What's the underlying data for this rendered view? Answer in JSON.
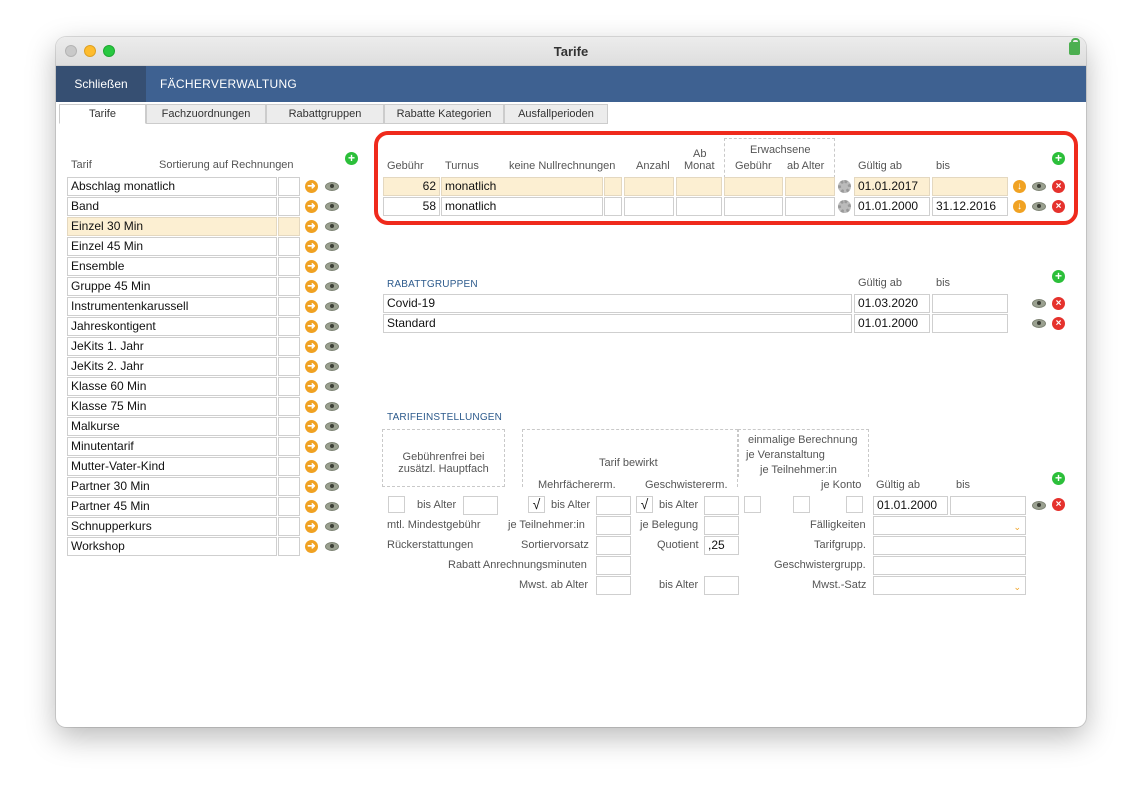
{
  "window": {
    "title": "Tarife"
  },
  "nav": {
    "close": "Schließen",
    "title": "FÄCHERVERWALTUNG"
  },
  "tabs": [
    "Tarife",
    "Fachzuordnungen",
    "Rabattgruppen",
    "Rabatte Kategorien",
    "Ausfallperioden"
  ],
  "left": {
    "header_tarif": "Tarif",
    "header_sort": "Sortierung auf Rechnungen",
    "items": [
      "Abschlag monatlich",
      "Band",
      "Einzel 30 Min",
      "Einzel 45 Min",
      "Ensemble",
      "Gruppe 45 Min",
      "Instrumentenkarussell",
      "Jahreskontigent",
      "JeKits 1. Jahr",
      "JeKits 2. Jahr",
      "Klasse 60 Min",
      "Klasse 75 Min",
      "Malkurse",
      "Minutentarif",
      "Mutter-Vater-Kind",
      "Partner 30 Min",
      "Partner 45 Min",
      "Schnupperkurs",
      "Workshop"
    ],
    "selected": "Einzel 30 Min"
  },
  "fees": {
    "headers": {
      "gebuehr": "Gebühr",
      "turnus": "Turnus",
      "keine": "keine Nullrechnungen",
      "anzahl": "Anzahl",
      "ab": "Ab",
      "monat": "Monat",
      "erwachsene": "Erwachsene",
      "erw_gebuehr": "Gebühr",
      "ab_alter": "ab Alter",
      "gueltig": "Gültig ab",
      "bis": "bis"
    },
    "rows": [
      {
        "gebuehr": "62",
        "turnus": "monatlich",
        "gueltig": "01.01.2017",
        "bis": ""
      },
      {
        "gebuehr": "58",
        "turnus": "monatlich",
        "gueltig": "01.01.2000",
        "bis": "31.12.2016"
      }
    ]
  },
  "rabatt": {
    "title": "RABATTGRUPPEN",
    "gueltig": "Gültig ab",
    "bis": "bis",
    "rows": [
      {
        "name": "Covid-19",
        "gueltig": "01.03.2020",
        "bis": ""
      },
      {
        "name": "Standard",
        "gueltig": "01.01.2000",
        "bis": ""
      }
    ]
  },
  "settings": {
    "title": "TARIFEINSTELLUNGEN",
    "gebuehrenfrei": "Gebührenfrei bei",
    "zusaetzl": "zusätzl. Hauptfach",
    "tarif_bewirkt": "Tarif bewirkt",
    "mehrfach": "Mehrfächererm.",
    "geschwister": "Geschwistererm.",
    "einmalig1": "einmalige Berechnung",
    "einmalig2": "je Veranstaltung",
    "einmalig3": "je Teilnehmer:in",
    "je_konto": "je Konto",
    "gueltig": "Gültig ab",
    "bis": "bis",
    "bis_alter": "bis Alter",
    "gueltig_value": "01.01.2000",
    "mindest": "mtl. Mindestgebühr",
    "je_teilnehmer": "je Teilnehmer:in",
    "je_belegung": "je Belegung",
    "faelligkeiten": "Fälligkeiten",
    "rueck": "Rückerstattungen",
    "sortier": "Sortiervorsatz",
    "quotient": "Quotient",
    "quotient_value": ",25",
    "tarifgrupp": "Tarifgrupp.",
    "rabatt_anrech": "Rabatt Anrechnungsminuten",
    "geschwistergrupp": "Geschwistergrupp.",
    "mwst_ab": "Mwst. ab Alter",
    "mwst_satz": "Mwst.-Satz",
    "check_mark": "√"
  },
  "icons": {
    "add": "+",
    "go": "➜",
    "del": "×",
    "down": "↓",
    "dropdown": "⌄"
  },
  "colors": {
    "nav": "#3e6191",
    "selected": "#fcefd2",
    "highlight": "#ef2a1c"
  }
}
